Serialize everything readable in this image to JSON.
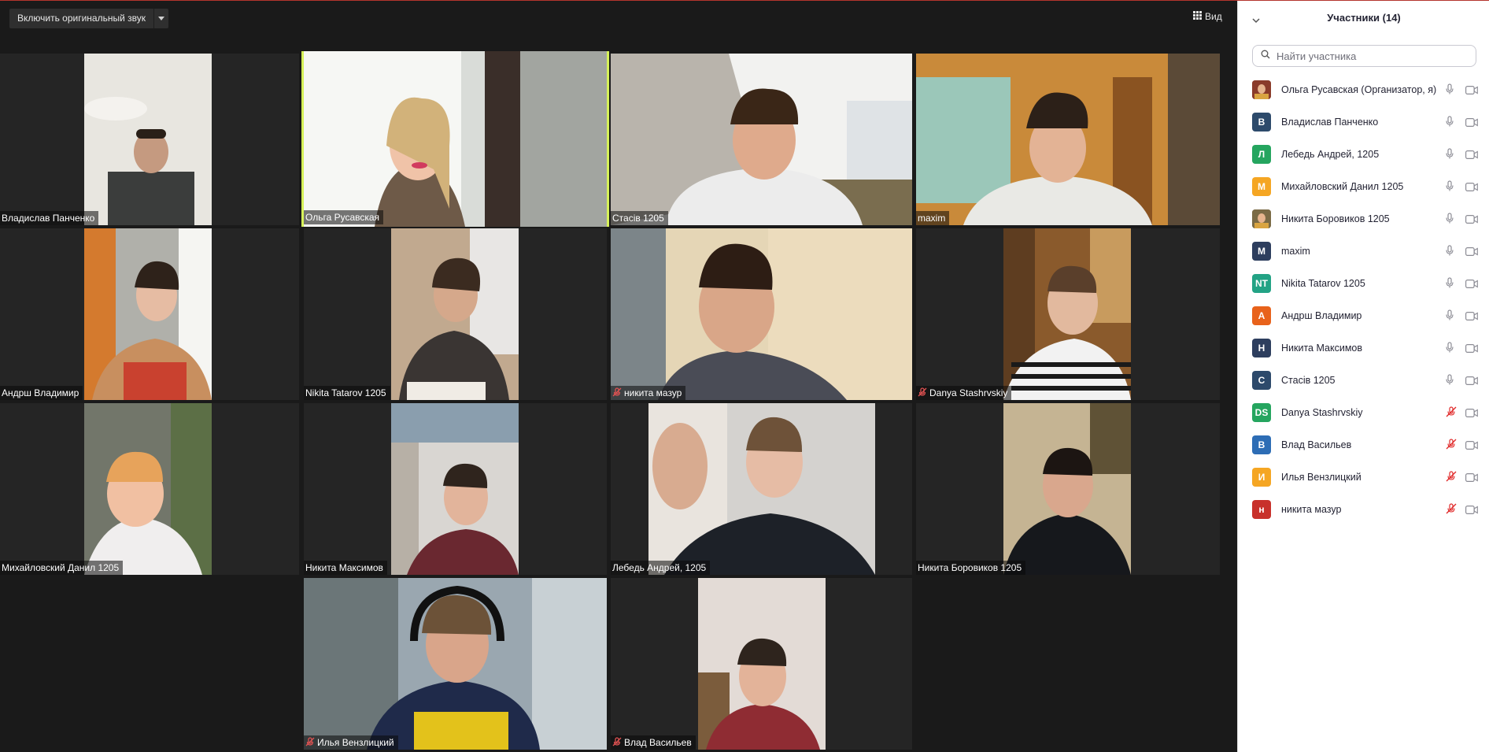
{
  "toolbar": {
    "unmute_original_label": "Включить оригинальный звук",
    "view_label": "Вид"
  },
  "tiles": [
    {
      "name": "Владислав Панченко",
      "muted": false,
      "active": false
    },
    {
      "name": "Ольга Русавская",
      "muted": false,
      "active": true
    },
    {
      "name": "Стасів 1205",
      "muted": false,
      "active": false
    },
    {
      "name": "maxim",
      "muted": false,
      "active": false
    },
    {
      "name": "Андрш Владимир",
      "muted": false,
      "active": false
    },
    {
      "name": "Nikita Tatarov 1205",
      "muted": false,
      "active": false
    },
    {
      "name": "никита мазур",
      "muted": true,
      "active": false
    },
    {
      "name": "Danya Stashrvskiy",
      "muted": true,
      "active": false
    },
    {
      "name": "Михайловский Данил 1205",
      "muted": false,
      "active": false
    },
    {
      "name": "Никита Максимов",
      "muted": false,
      "active": false
    },
    {
      "name": "Лебедь Андрей, 1205",
      "muted": false,
      "active": false
    },
    {
      "name": "Никита Боровиков 1205",
      "muted": false,
      "active": false
    },
    {
      "name": "Илья Вензлицкий",
      "muted": true,
      "active": false
    },
    {
      "name": "Влад Васильев",
      "muted": true,
      "active": false
    }
  ],
  "participants_panel": {
    "title": "Участники (14)",
    "search_placeholder": "Найти участника",
    "participants": [
      {
        "name": "Ольга Русавская (Организатор, я)",
        "initials": "",
        "avatar_color": "#8a3b2a",
        "photo": true,
        "muted": false
      },
      {
        "name": "Владислав Панченко",
        "initials": "В",
        "avatar_color": "#2d4a6b",
        "photo": false,
        "muted": false
      },
      {
        "name": "Лебедь Андрей, 1205",
        "initials": "Л",
        "avatar_color": "#25a55f",
        "photo": false,
        "muted": false
      },
      {
        "name": "Михайловский Данил 1205",
        "initials": "М",
        "avatar_color": "#f5a623",
        "photo": false,
        "muted": false
      },
      {
        "name": "Никита Боровиков 1205",
        "initials": "",
        "avatar_color": "#7a6a45",
        "photo": true,
        "muted": false
      },
      {
        "name": "maxim",
        "initials": "М",
        "avatar_color": "#2d3e5e",
        "photo": false,
        "muted": false
      },
      {
        "name": "Nikita Tatarov 1205",
        "initials": "NT",
        "avatar_color": "#23a385",
        "photo": false,
        "muted": false
      },
      {
        "name": "Андрш Владимир",
        "initials": "А",
        "avatar_color": "#e8621b",
        "photo": false,
        "muted": false
      },
      {
        "name": "Никита Максимов",
        "initials": "Н",
        "avatar_color": "#2d3e5e",
        "photo": false,
        "muted": false
      },
      {
        "name": "Стасів 1205",
        "initials": "С",
        "avatar_color": "#2d4a6b",
        "photo": false,
        "muted": false
      },
      {
        "name": "Danya Stashrvskiy",
        "initials": "DS",
        "avatar_color": "#25a55f",
        "photo": false,
        "muted": true
      },
      {
        "name": "Влад Васильев",
        "initials": "В",
        "avatar_color": "#2d6db5",
        "photo": false,
        "muted": true
      },
      {
        "name": "Илья Вензлицкий",
        "initials": "И",
        "avatar_color": "#f5a623",
        "photo": false,
        "muted": true
      },
      {
        "name": "никита мазур",
        "initials": "н",
        "avatar_color": "#c8312b",
        "photo": false,
        "muted": true
      }
    ]
  }
}
